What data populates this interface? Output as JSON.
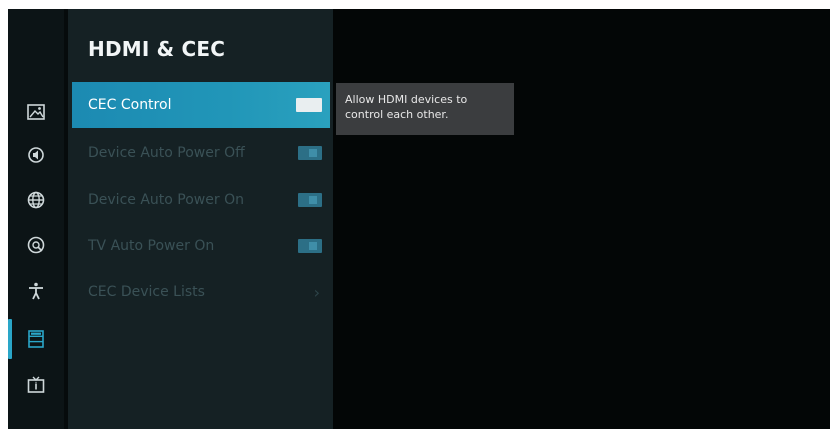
{
  "panel": {
    "title": "HDMI & CEC"
  },
  "menu": [
    {
      "label": "CEC Control",
      "control": "checkbox",
      "checked": true,
      "active": true
    },
    {
      "label": "Device Auto Power Off",
      "control": "checkbox",
      "checked": true,
      "active": false
    },
    {
      "label": "Device Auto Power On",
      "control": "checkbox",
      "checked": true,
      "active": false
    },
    {
      "label": "TV Auto Power On",
      "control": "checkbox",
      "checked": true,
      "active": false
    },
    {
      "label": "CEC Device Lists",
      "control": "chevron",
      "chevron": "›",
      "active": false
    }
  ],
  "tooltip": {
    "text": "Allow HDMI devices to control each other."
  },
  "rail": [
    {
      "icon": "picture-icon"
    },
    {
      "icon": "sound-icon"
    },
    {
      "icon": "network-icon"
    },
    {
      "icon": "remote-icon"
    },
    {
      "icon": "accessibility-icon"
    },
    {
      "icon": "system-icon",
      "selected": true
    },
    {
      "icon": "tv-info-icon"
    }
  ],
  "colors": {
    "accent": "#1c8ab2",
    "panel": "#152124",
    "rail": "#0c1416",
    "background": "#030606",
    "tooltip": "#3b3d3f"
  }
}
